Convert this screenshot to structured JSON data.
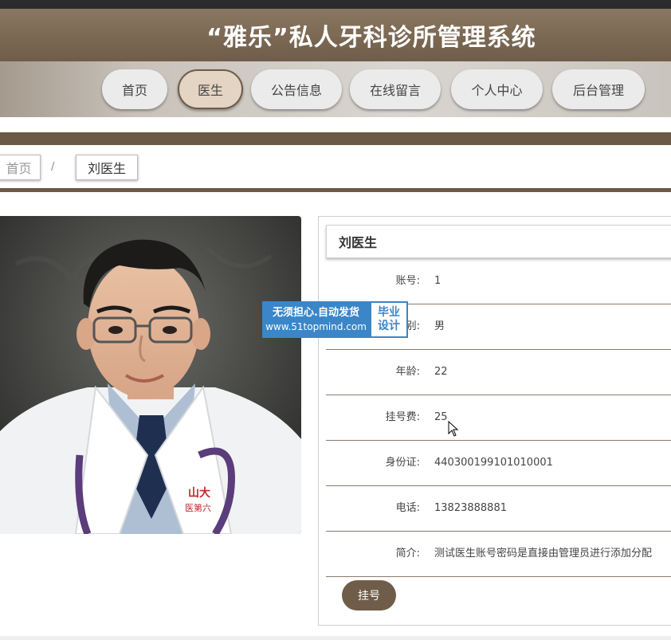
{
  "header": {
    "title": "“雅乐”私人牙科诊所管理系统"
  },
  "nav": {
    "items": [
      {
        "label": "首页"
      },
      {
        "label": "医生"
      },
      {
        "label": "公告信息"
      },
      {
        "label": "在线留言"
      },
      {
        "label": "个人中心"
      },
      {
        "label": "后台管理"
      }
    ],
    "active": "医生"
  },
  "breadcrumb": {
    "home": "首页",
    "separator": "/",
    "current": "刘医生"
  },
  "doctor": {
    "name": "刘医生",
    "fields": [
      {
        "label": "账号:",
        "value": "1"
      },
      {
        "label": "性别:",
        "value": "男"
      },
      {
        "label": "年龄:",
        "value": "22"
      },
      {
        "label": "挂号费:",
        "value": "25"
      },
      {
        "label": "身份证:",
        "value": "440300199101010001"
      },
      {
        "label": "电话:",
        "value": "13823888881"
      },
      {
        "label": "简介:",
        "value": "测试医生账号密码是直接由管理员进行添加分配"
      }
    ],
    "book_button": "挂号"
  },
  "coat_text": {
    "line1": "山大",
    "line2": "医第六"
  },
  "watermark": {
    "line1": "无须担心.自动发货",
    "line2": "www.51topmind.com",
    "right1": "毕业",
    "right2": "设计"
  },
  "colors": {
    "brand": "#6f5d4a",
    "watermark": "#3a86c8"
  }
}
